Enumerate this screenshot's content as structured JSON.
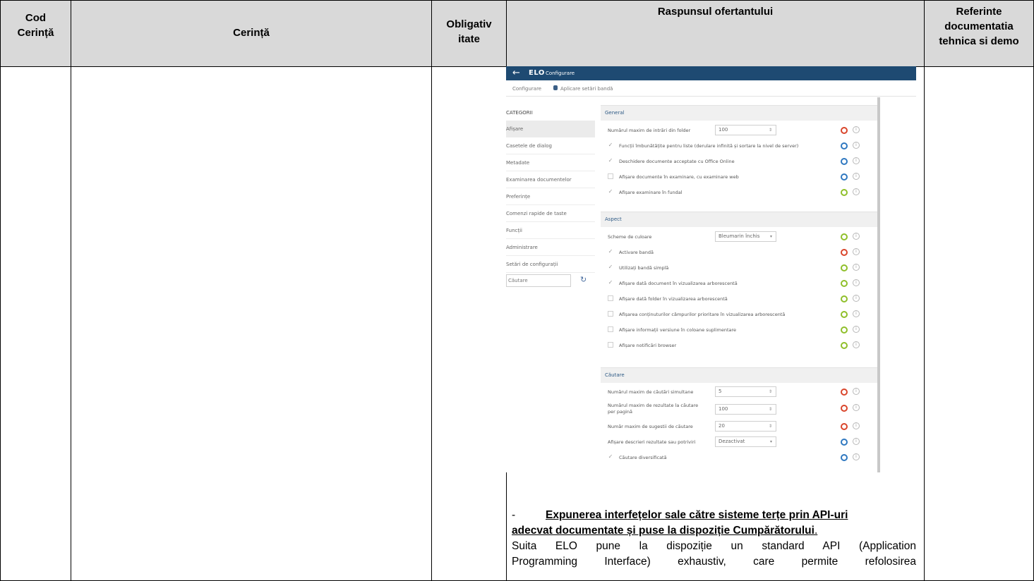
{
  "header": {
    "cod": [
      "Cod",
      "Cerință"
    ],
    "cerinta": "Cerință",
    "obligativitate": [
      "Obligativ",
      "itate"
    ],
    "raspuns": "Raspunsul ofertantului",
    "referinte": [
      "Referinte",
      "documentatia",
      "tehnica si demo"
    ]
  },
  "screenshot": {
    "back_icon": "arrow-left-icon",
    "logo": "ELO",
    "app_title": "Configurare",
    "breadcrumb": [
      "Configurare",
      "Aplicare setări bandă"
    ],
    "sidebar": {
      "heading": "CATEGORII",
      "items": [
        "Afișare",
        "Casetele de dialog",
        "Metadate",
        "Examinarea documentelor",
        "Preferințe",
        "Comenzi rapide de taste",
        "Funcții",
        "Administrare",
        "Setări de configurații"
      ],
      "search_placeholder": "Căutare"
    },
    "sections": [
      {
        "title": "General",
        "rows": [
          {
            "label": "Numărul maxim de intrări din folder",
            "value": "100",
            "status": "red"
          },
          {
            "label": "Funcții îmbunătățite pentru liste (derulare infinită și sortare la nivel de server)",
            "checked": true,
            "status": "blue"
          },
          {
            "label": "Deschidere documente acceptate cu Office Online",
            "checked": true,
            "status": "blue"
          },
          {
            "label": "Afișare documente în examinare, cu examinare web",
            "checked": false,
            "status": "blue"
          },
          {
            "label": "Afișare examinare în fundal",
            "checked": true,
            "status": "green"
          }
        ]
      },
      {
        "title": "Aspect",
        "rows": [
          {
            "label": "Scheme de culoare",
            "value": "Bleumarin închis",
            "status": "green"
          },
          {
            "label": "Activare bandă",
            "checked": true,
            "status": "red"
          },
          {
            "label": "Utilizați bandă simplă",
            "checked": true,
            "status": "green"
          },
          {
            "label": "Afișare dată document în vizualizarea arborescentă",
            "checked": true,
            "status": "green"
          },
          {
            "label": "Afișare dată folder în vizualizarea arborescentă",
            "checked": false,
            "status": "green"
          },
          {
            "label": "Afișarea conținuturilor câmpurilor prioritare în vizualizarea arborescentă",
            "checked": false,
            "status": "green"
          },
          {
            "label": "Afișare informații versiune în coloane suplimentare",
            "checked": false,
            "status": "green"
          },
          {
            "label": "Afișare notificări browser",
            "checked": false,
            "status": "green"
          }
        ]
      },
      {
        "title": "Căutare",
        "rows": [
          {
            "label": "Numărul maxim de căutări simultane",
            "value": "5",
            "status": "red"
          },
          {
            "label": "Numărul maxim de rezultate la căutare per pagină",
            "value": "100",
            "status": "red"
          },
          {
            "label": "Număr maxim de sugestii de căutare",
            "value": "20",
            "status": "red"
          },
          {
            "label": "Afișare descrieri rezultate sau potriviri",
            "value": "Dezactivat",
            "status": "blue"
          },
          {
            "label": "Căutare diversificată",
            "checked": true,
            "status": "blue"
          }
        ]
      }
    ]
  },
  "response": {
    "dash": "-",
    "heading_line1": "Expunerea interfețelor sale către sisteme terțe prin API-uri",
    "heading_line2": "adecvat documentate și puse la dispoziție Cumpărătorului",
    "heading_end": ".",
    "body_line1": "Suita ELO pune la dispoziție un standard API (Application",
    "body_line2": "Programming Interface) exhaustiv, care permite refolosirea"
  }
}
